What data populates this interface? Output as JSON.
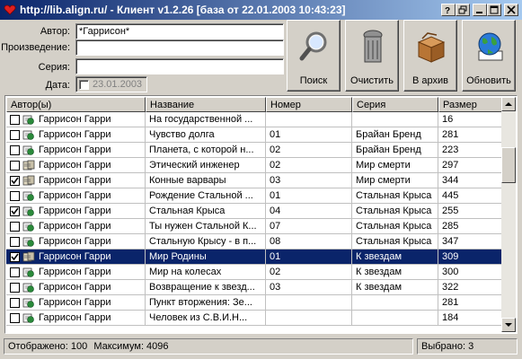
{
  "window": {
    "title": "http://lib.align.ru/ - Клиент v1.2.26   [база от 22.01.2003 10:43:23]"
  },
  "filters": {
    "author_label": "Автор:",
    "author_value": "*Гаррисон*",
    "work_label": "Произведение:",
    "work_value": "",
    "series_label": "Серия:",
    "series_value": "",
    "date_label": "Дата:",
    "date_value": "23.01.2003",
    "date_checked": false
  },
  "toolbar": {
    "search_label": "Поиск",
    "clear_label": "Очистить",
    "archive_label": "В архив",
    "refresh_label": "Обновить"
  },
  "columns": [
    "Автор(ы)",
    "Название",
    "Номер",
    "Серия",
    "Размер"
  ],
  "rows": [
    {
      "checked": false,
      "icon": "book-icon",
      "author": "Гаррисон Гарри",
      "title": "На государственной ...",
      "number": "",
      "series": "",
      "size": "16",
      "selected": false
    },
    {
      "checked": false,
      "icon": "book-icon",
      "author": "Гаррисон Гарри",
      "title": "Чувство долга",
      "number": "01",
      "series": "Брайан Бренд",
      "size": "281",
      "selected": false
    },
    {
      "checked": false,
      "icon": "book-icon",
      "author": "Гаррисон Гарри",
      "title": "Планета, с которой н...",
      "number": "02",
      "series": "Брайан Бренд",
      "size": "223",
      "selected": false
    },
    {
      "checked": false,
      "icon": "archive-book-icon",
      "author": "Гаррисон Гарри",
      "title": "Этический инженер",
      "number": "02",
      "series": "Мир смерти",
      "size": "297",
      "selected": false
    },
    {
      "checked": true,
      "icon": "archive-book-icon",
      "author": "Гаррисон Гарри",
      "title": "Конные варвары",
      "number": "03",
      "series": "Мир смерти",
      "size": "344",
      "selected": false
    },
    {
      "checked": false,
      "icon": "book-icon",
      "author": "Гаррисон Гарри",
      "title": "Рождение Стальной ...",
      "number": "01",
      "series": "Стальная Крыса",
      "size": "445",
      "selected": false
    },
    {
      "checked": true,
      "icon": "book-icon",
      "author": "Гаррисон Гарри",
      "title": "Стальная Крыса",
      "number": "04",
      "series": "Стальная Крыса",
      "size": "255",
      "selected": false
    },
    {
      "checked": false,
      "icon": "book-icon",
      "author": "Гаррисон Гарри",
      "title": "Ты нужен Стальной К...",
      "number": "07",
      "series": "Стальная Крыса",
      "size": "285",
      "selected": false
    },
    {
      "checked": false,
      "icon": "book-icon",
      "author": "Гаррисон Гарри",
      "title": "Стальную Крысу - в п...",
      "number": "08",
      "series": "Стальная Крыса",
      "size": "347",
      "selected": false
    },
    {
      "checked": true,
      "icon": "archive-book-icon",
      "author": "Гаррисон Гарри",
      "title": "Мир Родины",
      "number": "01",
      "series": "К звездам",
      "size": "309",
      "selected": true
    },
    {
      "checked": false,
      "icon": "book-icon",
      "author": "Гаррисон Гарри",
      "title": "Мир на колесах",
      "number": "02",
      "series": "К звездам",
      "size": "300",
      "selected": false
    },
    {
      "checked": false,
      "icon": "book-icon",
      "author": "Гаррисон Гарри",
      "title": "Возвращение к звезд...",
      "number": "03",
      "series": "К звездам",
      "size": "322",
      "selected": false
    },
    {
      "checked": false,
      "icon": "book-icon",
      "author": "Гаррисон Гарри",
      "title": "Пункт вторжения: Зе...",
      "number": "",
      "series": "",
      "size": "281",
      "selected": false
    },
    {
      "checked": false,
      "icon": "book-icon",
      "author": "Гаррисон Гарри",
      "title": "Человек из С.В.И.Н...",
      "number": "",
      "series": "",
      "size": "184",
      "selected": false
    }
  ],
  "status": {
    "shown": "Отображено: 100",
    "max": "Максимум: 4096",
    "selected": "Выбрано: 3"
  },
  "colors": {
    "title_start": "#0a246a",
    "title_end": "#a6caf0",
    "selection": "#0a246a",
    "face": "#d4d0c8"
  }
}
